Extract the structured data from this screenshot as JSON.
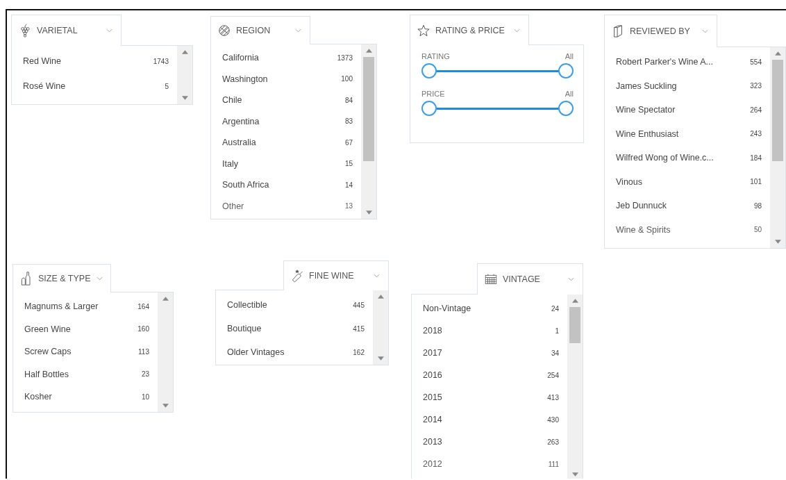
{
  "panels": [
    {
      "kind": "list",
      "title": "VARIETAL",
      "items": [
        {
          "label": "Red Wine",
          "count": "1743"
        },
        {
          "label": "Rosé Wine",
          "count": "5"
        }
      ]
    },
    {
      "kind": "list",
      "title": "REGION",
      "items": [
        {
          "label": "California",
          "count": "1373"
        },
        {
          "label": "Washington",
          "count": "100"
        },
        {
          "label": "Chile",
          "count": "84"
        },
        {
          "label": "Argentina",
          "count": "83"
        },
        {
          "label": "Australia",
          "count": "67"
        },
        {
          "label": "Italy",
          "count": "15"
        },
        {
          "label": "South Africa",
          "count": "14"
        },
        {
          "label": "Other",
          "count": "13"
        }
      ]
    },
    {
      "kind": "range",
      "title": "RATING & PRICE",
      "sliders": [
        {
          "label": "RATING",
          "value": "All",
          "handles": [
            {
              "level": 0
            },
            {
              "level": 1
            }
          ]
        },
        {
          "label": "PRICE",
          "value": "All",
          "handles": [
            {
              "level": 0
            },
            {
              "level": 1
            }
          ]
        }
      ]
    },
    {
      "kind": "list",
      "title": "REVIEWED BY",
      "items": [
        {
          "label": "Robert Parker's Wine A...",
          "count": "554"
        },
        {
          "label": "James Suckling",
          "count": "323"
        },
        {
          "label": "Wine Spectator",
          "count": "264"
        },
        {
          "label": "Wine Enthusiast",
          "count": "243"
        },
        {
          "label": "Wilfred Wong of Wine.c...",
          "count": "184"
        },
        {
          "label": "Vinous",
          "count": "101"
        },
        {
          "label": "Jeb Dunnuck",
          "count": "98"
        },
        {
          "label": "Wine & Spirits",
          "count": "50"
        }
      ]
    },
    {
      "kind": "list",
      "title": "SIZE & TYPE",
      "items": [
        {
          "label": "Magnums & Larger",
          "count": "164"
        },
        {
          "label": "Green Wine",
          "count": "160"
        },
        {
          "label": "Screw Caps",
          "count": "113"
        },
        {
          "label": "Half Bottles",
          "count": "23"
        },
        {
          "label": "Kosher",
          "count": "10"
        }
      ]
    },
    {
      "kind": "list",
      "title": "FINE WINE",
      "items": [
        {
          "label": "Collectible",
          "count": "445"
        },
        {
          "label": "Boutique",
          "count": "415"
        },
        {
          "label": "Older Vintages",
          "count": "162"
        }
      ]
    },
    {
      "kind": "list",
      "title": "VINTAGE",
      "items": [
        {
          "label": "Non-Vintage",
          "count": "24"
        },
        {
          "label": "2018",
          "count": "1"
        },
        {
          "label": "2017",
          "count": "34"
        },
        {
          "label": "2016",
          "count": "254"
        },
        {
          "label": "2015",
          "count": "413"
        },
        {
          "label": "2014",
          "count": "430"
        },
        {
          "label": "2013",
          "count": "263"
        },
        {
          "label": "2012",
          "count": "111"
        }
      ]
    }
  ]
}
